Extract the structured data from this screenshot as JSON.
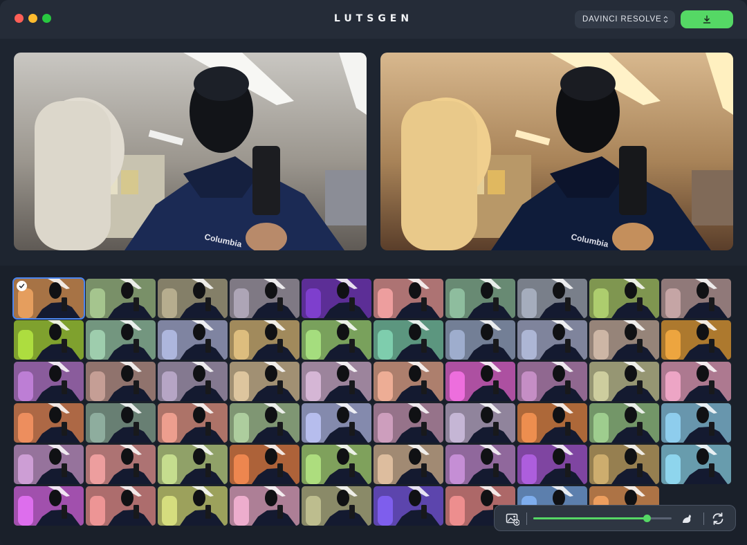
{
  "app": {
    "title": "LUTSGEN"
  },
  "header": {
    "format_select": {
      "value": "DAVINCI RESOLVE",
      "icon": "chevron-updown-icon"
    },
    "download_button": {
      "icon": "download-icon"
    }
  },
  "preview": {
    "original": {
      "icon": "photo"
    },
    "graded": {
      "icon": "photo"
    }
  },
  "toolbar": {
    "add_image": {
      "icon": "add-image-icon"
    },
    "strength": {
      "value": 0.82
    },
    "compare": {
      "icon": "compare-icon"
    },
    "regenerate": {
      "icon": "refresh-icon"
    }
  },
  "colors": {
    "accent_green": "#55d865",
    "selection_blue": "#4b86f0"
  },
  "luts": {
    "selected_index": 0,
    "items": [
      "#e8a060",
      "#a8c890",
      "#b8b090",
      "#b0a8b8",
      "#8040d0",
      "#f0a0a0",
      "#90c0a0",
      "#a8b0c0",
      "#b0d070",
      "#c8a8a8",
      "#b0e040",
      "#a0d0b0",
      "#b0b8e0",
      "#e0c080",
      "#a8e080",
      "#80d0b0",
      "#a0b0d0",
      "#b0b8d8",
      "#d0b8a8",
      "#f0a840",
      "#c080d8",
      "#c8a098",
      "#b8a8c8",
      "#e0c8a0",
      "#d8b8d8",
      "#f0b098",
      "#f070e0",
      "#c890c8",
      "#d0d0a0",
      "#f0a8c8",
      "#f09060",
      "#90b0a0",
      "#f0a090",
      "#b0d0a0",
      "#b8c0f0",
      "#d0a0c0",
      "#c8b8d8",
      "#f09050",
      "#a0d090",
      "#90d0f0",
      "#d0a0d8",
      "#f0a0a0",
      "#c8e090",
      "#f08850",
      "#b0e080",
      "#e0c0a0",
      "#c890d8",
      "#b060e0",
      "#d0b070",
      "#90d8f0",
      "#e070f0",
      "#f09898",
      "#d8e080",
      "#f0b0d0",
      "#c0c090",
      "#8060f0",
      "#f09090",
      "#80b0f0",
      "#f0a060"
    ]
  }
}
